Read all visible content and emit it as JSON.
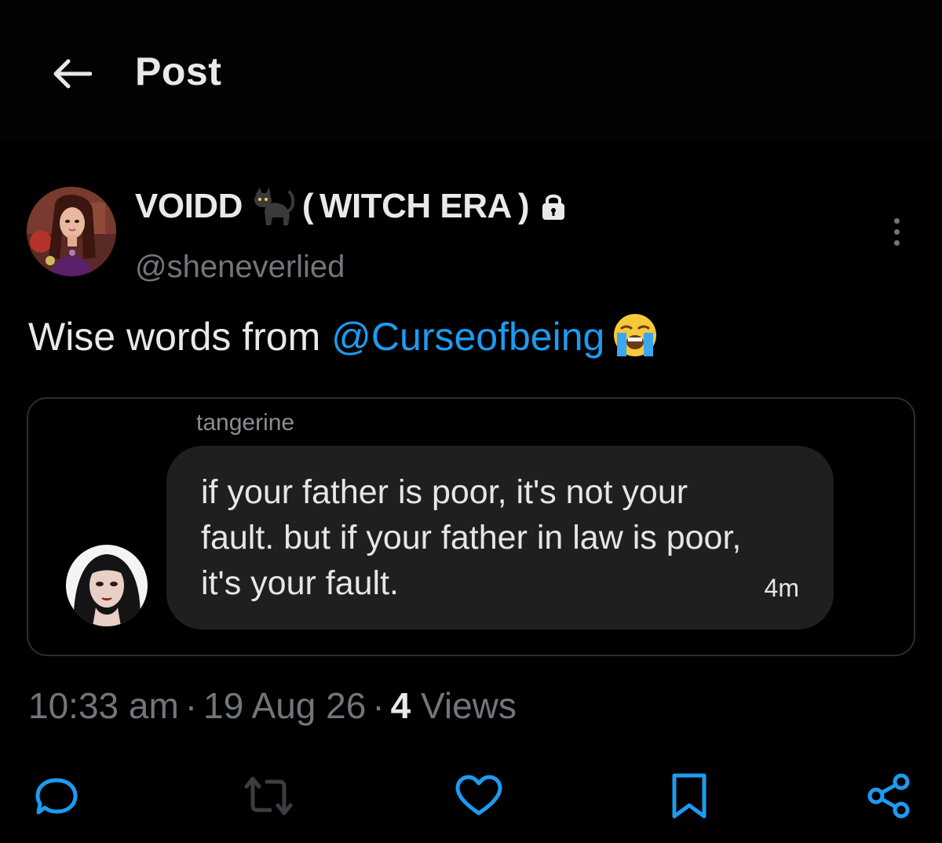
{
  "header": {
    "title": "Post"
  },
  "author": {
    "display_name_start": "VOIDD",
    "display_name_kaomoji_open": "(",
    "display_name_core": "WITCH ERA",
    "display_name_kaomoji_close": ")",
    "handle": "@sheneverlied",
    "protected": true
  },
  "post": {
    "text_prefix": "Wise words from ",
    "mention": "@Curseofbeing",
    "emoji": "loudly-crying-face"
  },
  "quoted": {
    "name": "tangerine",
    "message": "if your father is poor, it's not your fault. but if your father in law is poor, it's your fault.",
    "time": "4m"
  },
  "meta": {
    "time": "10:33 am",
    "separator": "·",
    "date": "19 Aug 26",
    "views_count": "4",
    "views_label": " Views"
  },
  "actions": [
    {
      "name": "reply",
      "icon": "reply-icon"
    },
    {
      "name": "repost",
      "icon": "repost-icon"
    },
    {
      "name": "like",
      "icon": "heart-icon"
    },
    {
      "name": "bookmark",
      "icon": "bookmark-icon"
    },
    {
      "name": "share",
      "icon": "share-icon"
    }
  ],
  "colors": {
    "background": "#000000",
    "text": "#e7e9ea",
    "secondary": "#71767b",
    "link": "#1d9bf0",
    "bubble": "#1e1f21"
  }
}
